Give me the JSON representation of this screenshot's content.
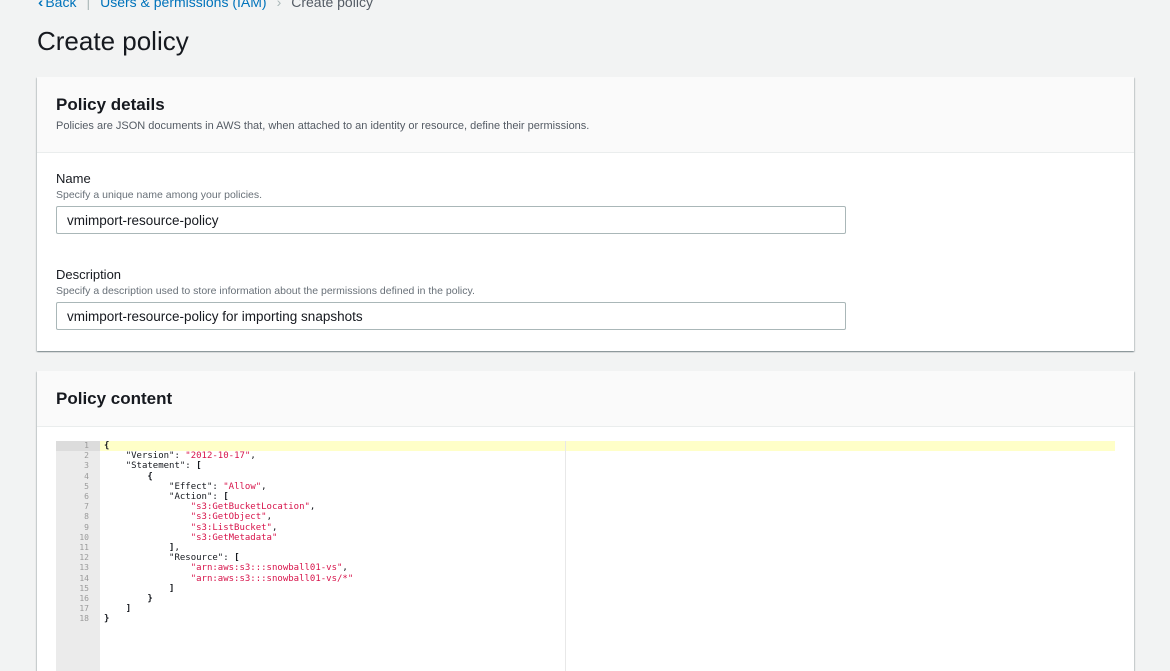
{
  "breadcrumb": {
    "back": "Back",
    "parent": "Users & permissions (IAM)",
    "current": "Create policy"
  },
  "page_title": "Create policy",
  "details": {
    "title": "Policy details",
    "description": "Policies are JSON documents in AWS that, when attached to an identity or resource, define their permissions.",
    "name_label": "Name",
    "name_hint": "Specify a unique name among your policies.",
    "name_value": "vmimport-resource-policy",
    "desc_label": "Description",
    "desc_hint": "Specify a description used to store information about the permissions defined in the policy.",
    "desc_value": "vmimport-resource-policy for importing snapshots"
  },
  "content": {
    "title": "Policy content",
    "lines": [
      "{",
      "    \"Version\": \"2012-10-17\",",
      "    \"Statement\": [",
      "        {",
      "            \"Effect\": \"Allow\",",
      "            \"Action\": [",
      "                \"s3:GetBucketLocation\",",
      "                \"s3:GetObject\",",
      "                \"s3:ListBucket\",",
      "                \"s3:GetMetadata\"",
      "            ],",
      "            \"Resource\": [",
      "                \"arn:aws:s3:::snowball01-vs\",",
      "                \"arn:aws:s3:::snowball01-vs/*\"",
      "            ]",
      "        }",
      "    ]",
      "}"
    ]
  },
  "colors": {
    "link": "#0073bb",
    "string": "#d7144b",
    "active_line": "#ffffc8"
  }
}
